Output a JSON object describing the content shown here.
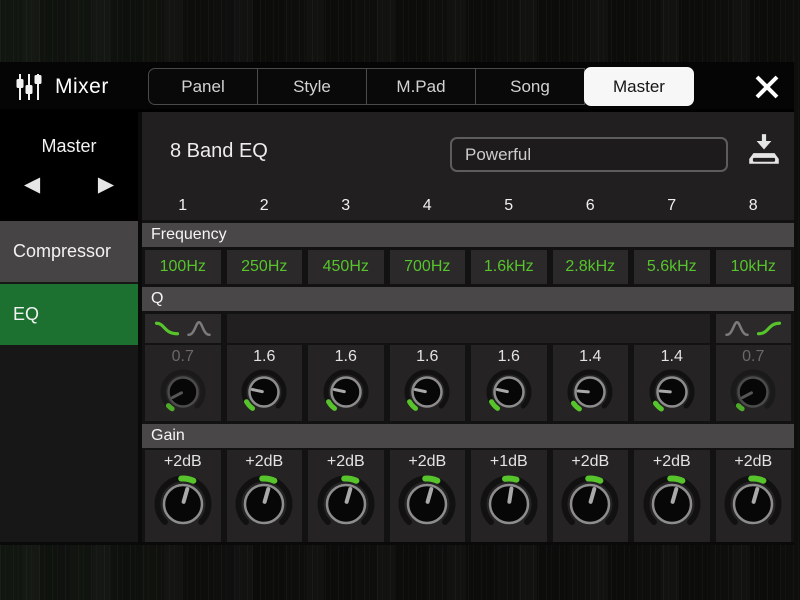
{
  "colors": {
    "accent_green": "#57c42c",
    "active_tab_bg": "#f7f7f7",
    "eq_selected_bg": "#1d7130",
    "row_header_bg": "#4a4748",
    "panel_bg": "#211f20"
  },
  "titlebar": {
    "app_title": "Mixer",
    "app_icon": "mixer-faders-icon",
    "tabs": [
      {
        "label": "Panel",
        "active": false
      },
      {
        "label": "Style",
        "active": false
      },
      {
        "label": "M.Pad",
        "active": false
      },
      {
        "label": "Song",
        "active": false
      },
      {
        "label": "Master",
        "active": true
      }
    ],
    "close_icon": "close-x-icon"
  },
  "sidebar": {
    "selector_label": "Master",
    "prev_icon": "left-triangle-icon",
    "next_icon": "right-triangle-icon",
    "items": [
      {
        "label": "Compressor",
        "active": false
      },
      {
        "label": "EQ",
        "active": true
      }
    ]
  },
  "main": {
    "title": "8 Band EQ",
    "preset": {
      "value": "Powerful"
    },
    "save_icon": "save-to-disk-icon",
    "band_numbers": [
      "1",
      "2",
      "3",
      "4",
      "5",
      "6",
      "7",
      "8"
    ],
    "frequency": {
      "label": "Frequency",
      "values": [
        "100Hz",
        "250Hz",
        "450Hz",
        "700Hz",
        "1.6kHz",
        "2.8kHz",
        "5.6kHz",
        "10kHz"
      ]
    },
    "q": {
      "label": "Q",
      "filter_selectors": [
        {
          "band": 1,
          "icons": [
            {
              "type": "shelf-falling",
              "selected": true
            },
            {
              "type": "peak",
              "selected": false
            }
          ]
        },
        {
          "band": 8,
          "icons": [
            {
              "type": "peak",
              "selected": false
            },
            {
              "type": "shelf-rising",
              "selected": true
            }
          ]
        }
      ],
      "knobs": [
        {
          "value": "0.7",
          "dim": true,
          "pointer": -118,
          "arc": [
            -147,
            -133
          ]
        },
        {
          "value": "1.6",
          "dim": false,
          "pointer": -78,
          "arc": [
            -145,
            -119
          ]
        },
        {
          "value": "1.6",
          "dim": false,
          "pointer": -78,
          "arc": [
            -145,
            -119
          ]
        },
        {
          "value": "1.6",
          "dim": false,
          "pointer": -78,
          "arc": [
            -145,
            -119
          ]
        },
        {
          "value": "1.6",
          "dim": false,
          "pointer": -78,
          "arc": [
            -145,
            -119
          ]
        },
        {
          "value": "1.4",
          "dim": false,
          "pointer": -85,
          "arc": [
            -148,
            -124
          ]
        },
        {
          "value": "1.4",
          "dim": false,
          "pointer": -85,
          "arc": [
            -148,
            -124
          ]
        },
        {
          "value": "0.7",
          "dim": true,
          "pointer": -118,
          "arc": [
            -147,
            -133
          ]
        }
      ]
    },
    "gain": {
      "label": "Gain",
      "knobs": [
        {
          "value": "+2dB",
          "dim": false,
          "pointer": 16,
          "arc": [
            -4,
            24
          ]
        },
        {
          "value": "+2dB",
          "dim": false,
          "pointer": 16,
          "arc": [
            -4,
            24
          ]
        },
        {
          "value": "+2dB",
          "dim": false,
          "pointer": 16,
          "arc": [
            -4,
            24
          ]
        },
        {
          "value": "+2dB",
          "dim": false,
          "pointer": 16,
          "arc": [
            -4,
            24
          ]
        },
        {
          "value": "+1dB",
          "dim": false,
          "pointer": 9,
          "arc": [
            -9,
            17
          ]
        },
        {
          "value": "+2dB",
          "dim": false,
          "pointer": 16,
          "arc": [
            -4,
            24
          ]
        },
        {
          "value": "+2dB",
          "dim": false,
          "pointer": 16,
          "arc": [
            -4,
            24
          ]
        },
        {
          "value": "+2dB",
          "dim": false,
          "pointer": 16,
          "arc": [
            -4,
            24
          ]
        }
      ]
    }
  }
}
